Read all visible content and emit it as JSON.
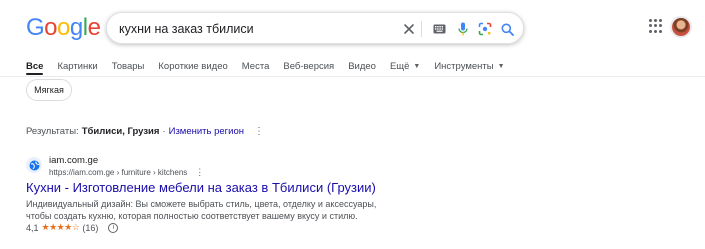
{
  "logo": {
    "letters": [
      "G",
      "o",
      "o",
      "g",
      "l",
      "e"
    ],
    "colors": [
      "#4285F4",
      "#EA4335",
      "#FBBC05",
      "#4285F4",
      "#34A853",
      "#EA4335"
    ]
  },
  "search": {
    "value": "кухни на заказ тбилиси",
    "icons": [
      "close-icon",
      "keyboard-icon",
      "microphone-icon",
      "lens-icon",
      "search-icon"
    ]
  },
  "tabs": [
    {
      "label": "Все",
      "active": true
    },
    {
      "label": "Картинки"
    },
    {
      "label": "Товары"
    },
    {
      "label": "Короткие видео"
    },
    {
      "label": "Места"
    },
    {
      "label": "Веб-версия"
    },
    {
      "label": "Видео"
    },
    {
      "label": "Ещё",
      "dropdown": true
    },
    {
      "label": "Инструменты",
      "dropdown": true
    }
  ],
  "chip": {
    "label": "Мягкая"
  },
  "region": {
    "prefix": "Результаты:",
    "location": "Тбилиси, Грузия",
    "separator": "·",
    "change_link": "Изменить регион"
  },
  "result": {
    "site_name": "iam.com.ge",
    "url": "https://iam.com.ge › furniture › kitchens",
    "title": "Кухни - Изготовление мебели на заказ в Тбилиси (Грузии)",
    "snippet": "Индивидуальный дизайн: Вы сможете выбрать стиль, цвета, отделку и аксессуары, чтобы создать кухню, которая полностью соответствует вашему вкусу и стилю.",
    "rating_value": "4,1",
    "stars": "★★★★☆",
    "rating_out_of": 5,
    "review_count": "(16)"
  },
  "colors": {
    "link": "#1a0dab",
    "text": "#202124",
    "secondary": "#4d5156",
    "star": "#e7711b"
  }
}
